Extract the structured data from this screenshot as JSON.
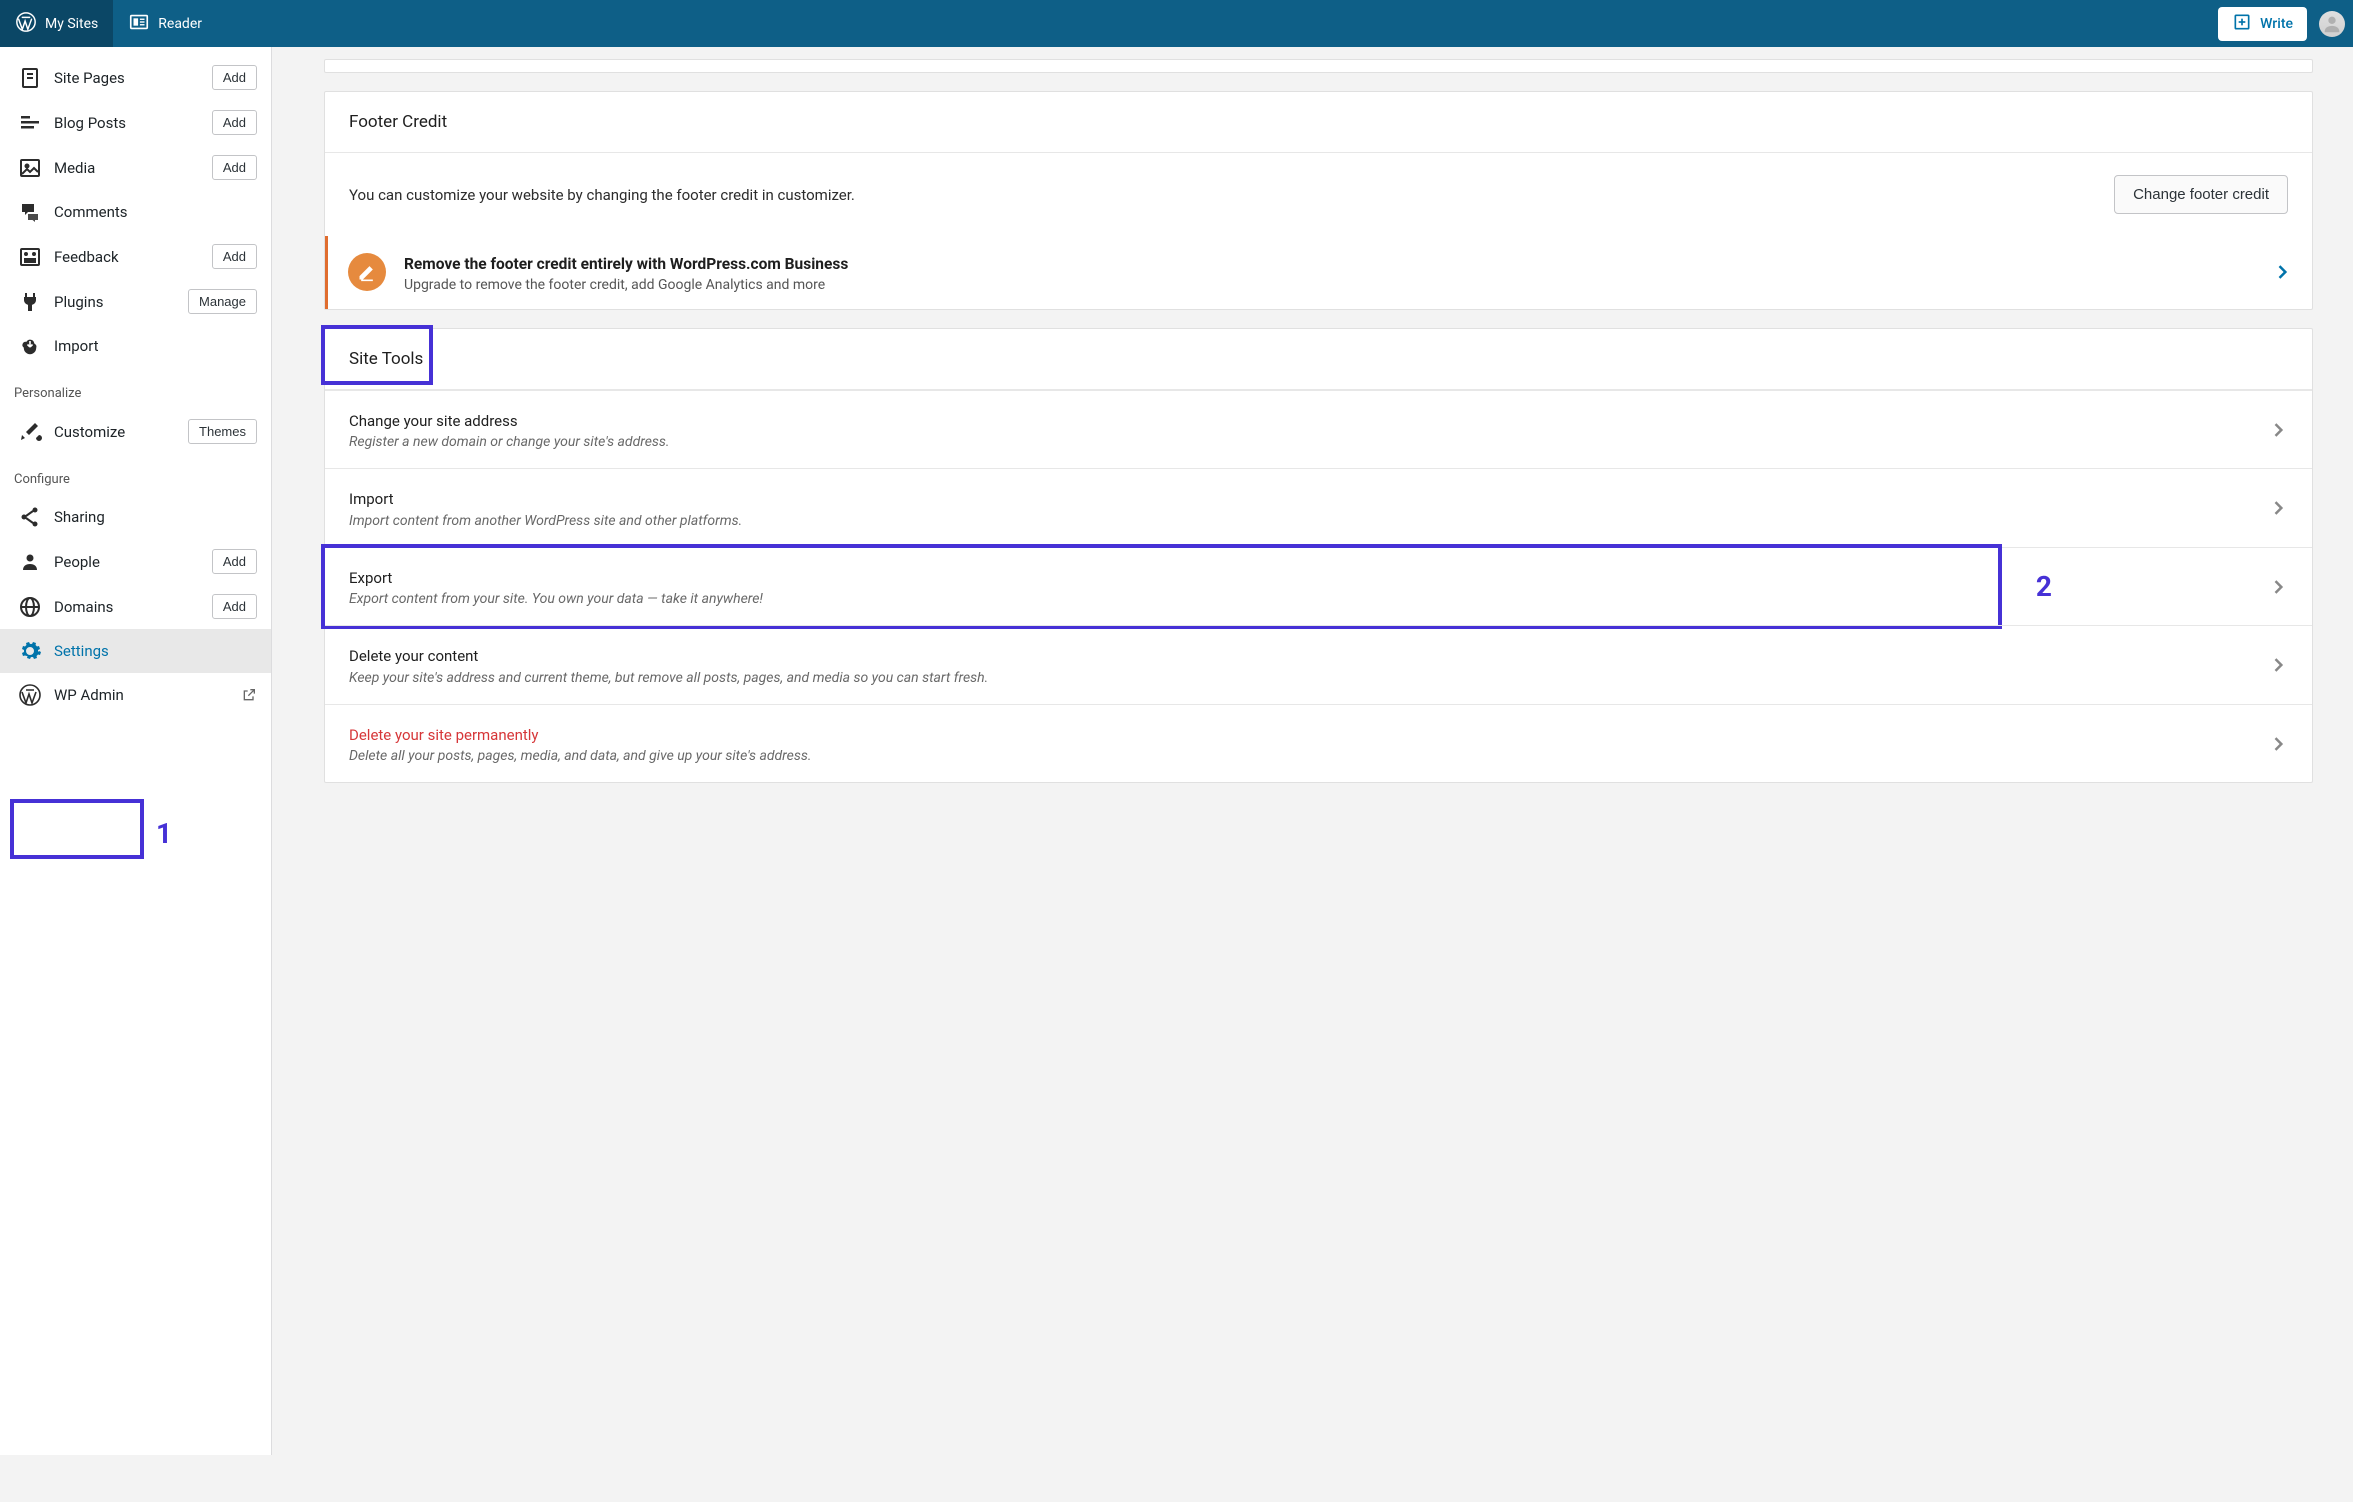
{
  "masterbar": {
    "my_sites": "My Sites",
    "reader": "Reader",
    "write": "Write"
  },
  "sidebar": {
    "items": [
      {
        "label": "Site Pages",
        "btn": "Add"
      },
      {
        "label": "Blog Posts",
        "btn": "Add"
      },
      {
        "label": "Media",
        "btn": "Add"
      },
      {
        "label": "Comments",
        "btn": null
      },
      {
        "label": "Feedback",
        "btn": "Add"
      },
      {
        "label": "Plugins",
        "btn": "Manage"
      },
      {
        "label": "Import",
        "btn": null
      }
    ],
    "heading_personalize": "Personalize",
    "customize": {
      "label": "Customize",
      "btn": "Themes"
    },
    "heading_configure": "Configure",
    "configure": [
      {
        "label": "Sharing",
        "btn": null
      },
      {
        "label": "People",
        "btn": "Add"
      },
      {
        "label": "Domains",
        "btn": "Add"
      },
      {
        "label": "Settings",
        "btn": null
      },
      {
        "label": "WP Admin",
        "btn": null
      }
    ]
  },
  "footer_credit": {
    "header": "Footer Credit",
    "body": "You can customize your website by changing the footer credit in customizer.",
    "button": "Change footer credit"
  },
  "upsell": {
    "title": "Remove the footer credit entirely with WordPress.com Business",
    "sub": "Upgrade to remove the footer credit, add Google Analytics and more"
  },
  "site_tools": {
    "header": "Site Tools",
    "rows": [
      {
        "title": "Change your site address",
        "sub": "Register a new domain or change your site's address."
      },
      {
        "title": "Import",
        "sub": "Import content from another WordPress site and other platforms."
      },
      {
        "title": "Export",
        "sub": "Export content from your site. You own your data — take it anywhere!"
      },
      {
        "title": "Delete your content",
        "sub": "Keep your site's address and current theme, but remove all posts, pages, and media so you can start fresh."
      },
      {
        "title": "Delete your site permanently",
        "sub": "Delete all your posts, pages, media, and data, and give up your site's address."
      }
    ]
  },
  "annotations": {
    "one": "1",
    "two": "2"
  }
}
